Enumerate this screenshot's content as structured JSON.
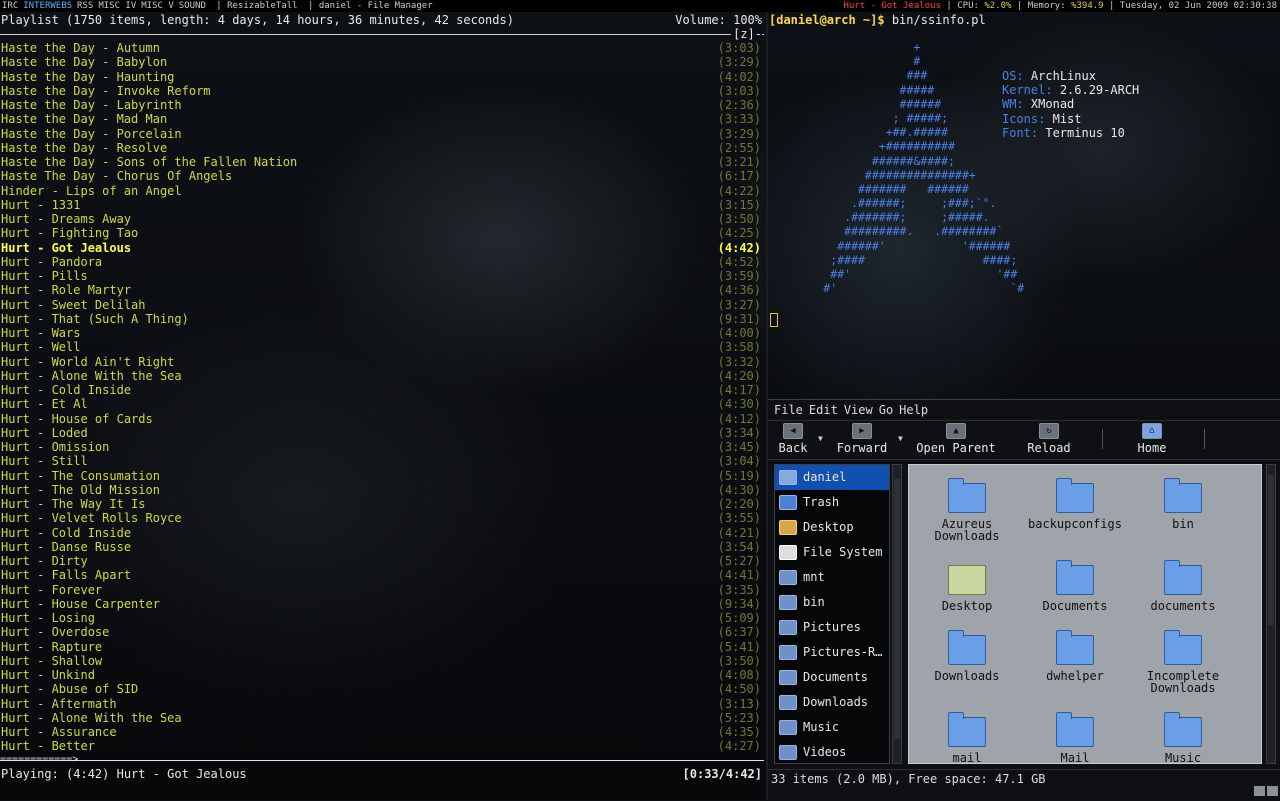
{
  "statusbar": {
    "workspaces": [
      "IRC",
      "INTERWEBS",
      "RSS",
      "MISC IV",
      "MISC V",
      "SOUND"
    ],
    "active_workspace": "INTERWEBS",
    "layout": "| ResizableTall",
    "window_title": "| daniel - File Manager",
    "now_playing": "Hurt - Got Jealous",
    "cpu_label": "| CPU:",
    "cpu_value": "%2.0%",
    "memory_label": "| Memory:",
    "memory_value": "%394.9",
    "datetime": "| Tuesday, 02 Jun 2009 02:30:38"
  },
  "ncmpc": {
    "header": "Playlist (1750 items, length: 4 days, 14 hours, 36 minutes, 42 seconds)",
    "volume": "Volume: 100%",
    "flags": "[z]-",
    "current_index": 14,
    "progress_bar": "============>",
    "playing": "Playing: (4:42) Hurt - Got Jealous",
    "elapsed_total": "[0:33/4:42]",
    "playlist": [
      {
        "title": "Haste the Day - Autumn",
        "duration": "(3:03)"
      },
      {
        "title": "Haste the Day - Babylon",
        "duration": "(3:29)"
      },
      {
        "title": "Haste the Day - Haunting",
        "duration": "(4:02)"
      },
      {
        "title": "Haste the Day - Invoke Reform",
        "duration": "(3:03)"
      },
      {
        "title": "Haste the Day - Labyrinth",
        "duration": "(2:36)"
      },
      {
        "title": "Haste the Day - Mad Man",
        "duration": "(3:33)"
      },
      {
        "title": "Haste the Day - Porcelain",
        "duration": "(3:29)"
      },
      {
        "title": "Haste the Day - Resolve",
        "duration": "(2:55)"
      },
      {
        "title": "Haste the Day - Sons of the Fallen Nation",
        "duration": "(3:21)"
      },
      {
        "title": "Haste The Day - Chorus Of Angels",
        "duration": "(6:17)"
      },
      {
        "title": "Hinder - Lips of an Angel",
        "duration": "(4:22)"
      },
      {
        "title": "Hurt - 1331",
        "duration": "(3:15)"
      },
      {
        "title": "Hurt - Dreams Away",
        "duration": "(3:50)"
      },
      {
        "title": "Hurt - Fighting Tao",
        "duration": "(4:25)"
      },
      {
        "title": "Hurt - Got Jealous",
        "duration": "(4:42)"
      },
      {
        "title": "Hurt - Pandora",
        "duration": "(4:52)"
      },
      {
        "title": "Hurt - Pills",
        "duration": "(3:59)"
      },
      {
        "title": "Hurt - Role Martyr",
        "duration": "(4:36)"
      },
      {
        "title": "Hurt - Sweet Delilah",
        "duration": "(3:27)"
      },
      {
        "title": "Hurt - That (Such A Thing)",
        "duration": "(9:31)"
      },
      {
        "title": "Hurt - Wars",
        "duration": "(4:00)"
      },
      {
        "title": "Hurt - Well",
        "duration": "(3:58)"
      },
      {
        "title": "Hurt - World Ain't Right",
        "duration": "(3:32)"
      },
      {
        "title": "Hurt - Alone With the Sea",
        "duration": "(4:20)"
      },
      {
        "title": "Hurt - Cold Inside",
        "duration": "(4:17)"
      },
      {
        "title": "Hurt - Et Al",
        "duration": "(4:30)"
      },
      {
        "title": "Hurt - House of Cards",
        "duration": "(4:12)"
      },
      {
        "title": "Hurt - Loded",
        "duration": "(3:34)"
      },
      {
        "title": "Hurt - Omission",
        "duration": "(3:45)"
      },
      {
        "title": "Hurt - Still",
        "duration": "(3:04)"
      },
      {
        "title": "Hurt - The Consumation",
        "duration": "(5:19)"
      },
      {
        "title": "Hurt - The Old Mission",
        "duration": "(4:30)"
      },
      {
        "title": "Hurt - The Way It Is",
        "duration": "(2:20)"
      },
      {
        "title": "Hurt - Velvet Rolls Royce",
        "duration": "(3:55)"
      },
      {
        "title": "Hurt - Cold Inside",
        "duration": "(4:21)"
      },
      {
        "title": "Hurt - Danse Russe",
        "duration": "(3:54)"
      },
      {
        "title": "Hurt - Dirty",
        "duration": "(5:27)"
      },
      {
        "title": "Hurt - Falls Apart",
        "duration": "(4:41)"
      },
      {
        "title": "Hurt - Forever",
        "duration": "(3:35)"
      },
      {
        "title": "Hurt - House Carpenter",
        "duration": "(9:34)"
      },
      {
        "title": "Hurt - Losing",
        "duration": "(5:09)"
      },
      {
        "title": "Hurt - Overdose",
        "duration": "(6:37)"
      },
      {
        "title": "Hurt - Rapture",
        "duration": "(5:41)"
      },
      {
        "title": "Hurt - Shallow",
        "duration": "(3:50)"
      },
      {
        "title": "Hurt - Unkind",
        "duration": "(4:08)"
      },
      {
        "title": "Hurt - Abuse of SID",
        "duration": "(4:50)"
      },
      {
        "title": "Hurt - Aftermath",
        "duration": "(3:13)"
      },
      {
        "title": "Hurt - Alone With the Sea",
        "duration": "(5:23)"
      },
      {
        "title": "Hurt - Assurance",
        "duration": "(4:35)"
      },
      {
        "title": "Hurt - Better",
        "duration": "(4:27)"
      }
    ]
  },
  "terminal": {
    "prompt_user": "[daniel@arch ~]$",
    "command": "bin/ssinfo.pl",
    "logo_color": "#4b7fe3",
    "logo_lines": [
      "                     +",
      "                     #",
      "                    ###",
      "                   #####",
      "                   ######",
      "                  ; #####;",
      "                 +##.#####",
      "                +##########",
      "               ######&####;",
      "              ###############+",
      "             #######   ######",
      "            .######;     ;###;`\".",
      "           .#######;     ;#####.",
      "           #########.   .########`",
      "          ######'           '######",
      "         ;####                 ####;",
      "         ##'                     '##",
      "        #'                         `#"
    ],
    "sysinfo": [
      {
        "key": "OS:",
        "value": "ArchLinux"
      },
      {
        "key": "Kernel:",
        "value": "2.6.29-ARCH"
      },
      {
        "key": "WM:",
        "value": "XMonad"
      },
      {
        "key": "Icons:",
        "value": "Mist"
      },
      {
        "key": "Font:",
        "value": "Terminus 10"
      }
    ]
  },
  "filemanager": {
    "menu": [
      "File",
      "Edit",
      "View",
      "Go",
      "Help"
    ],
    "toolbar": {
      "back": "Back",
      "forward": "Forward",
      "open_parent": "Open Parent",
      "reload": "Reload",
      "home": "Home"
    },
    "sidebar": [
      {
        "label": "daniel",
        "icon": "home-folder"
      },
      {
        "label": "Trash",
        "icon": "trash"
      },
      {
        "label": "Desktop",
        "icon": "desktop"
      },
      {
        "label": "File System",
        "icon": "drive"
      },
      {
        "label": "mnt",
        "icon": "folder"
      },
      {
        "label": "bin",
        "icon": "folder"
      },
      {
        "label": "Pictures",
        "icon": "folder"
      },
      {
        "label": "Pictures-R…",
        "icon": "folder"
      },
      {
        "label": "Documents",
        "icon": "folder"
      },
      {
        "label": "Downloads",
        "icon": "folder"
      },
      {
        "label": "Music",
        "icon": "folder"
      },
      {
        "label": "Videos",
        "icon": "folder"
      }
    ],
    "items": [
      {
        "line1": "Azureus",
        "line2": "Downloads",
        "type": "folder"
      },
      {
        "line1": "backupconfigs",
        "line2": "",
        "type": "folder"
      },
      {
        "line1": "bin",
        "line2": "",
        "type": "folder"
      },
      {
        "line1": "Desktop",
        "line2": "",
        "type": "desktop"
      },
      {
        "line1": "Documents",
        "line2": "",
        "type": "folder"
      },
      {
        "line1": "documents",
        "line2": "",
        "type": "folder"
      },
      {
        "line1": "Downloads",
        "line2": "",
        "type": "folder"
      },
      {
        "line1": "dwhelper",
        "line2": "",
        "type": "folder"
      },
      {
        "line1": "Incomplete",
        "line2": "Downloads",
        "type": "folder"
      },
      {
        "line1": "mail",
        "line2": "",
        "type": "folder"
      },
      {
        "line1": "Mail",
        "line2": "",
        "type": "folder"
      },
      {
        "line1": "Music",
        "line2": "",
        "type": "folder"
      }
    ],
    "status": "33 items (2.0 MB), Free space: 47.1 GB"
  },
  "colors": {
    "playlist_text": "#d2d840",
    "playlist_duration": "#6e7a2a",
    "current_track": "#ffff4a",
    "accent_blue": "#4b7fe3",
    "selection": "#1250b0"
  }
}
